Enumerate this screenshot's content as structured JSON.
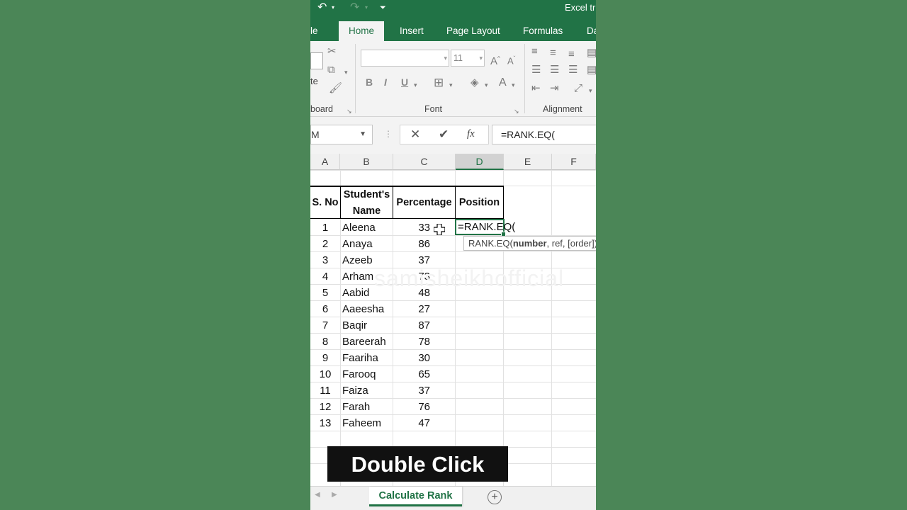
{
  "window": {
    "title": "Excel tri"
  },
  "qat": {
    "undo": "↶",
    "redo": "↷",
    "customize": "⏷"
  },
  "tabs": [
    {
      "label": "le"
    },
    {
      "label": "Home"
    },
    {
      "label": "Insert"
    },
    {
      "label": "Page Layout"
    },
    {
      "label": "Formulas"
    },
    {
      "label": "Da"
    }
  ],
  "ribbon": {
    "clipboard_label": "board",
    "paste_label": "te",
    "font_group_label": "Font",
    "alignment_group_label": "Alignment",
    "font_name": "",
    "font_size": "11",
    "bold": "B",
    "italic": "I",
    "underline": "U"
  },
  "formula_bar": {
    "name_box": "M",
    "fx": "fx",
    "formula": "=RANK.EQ("
  },
  "columns": [
    "A",
    "B",
    "C",
    "D",
    "E",
    "F"
  ],
  "selected_column": "D",
  "table": {
    "headers": [
      "S. No",
      "Student's Name",
      "Percentage",
      "Position"
    ],
    "header_name_line1": "Student's",
    "header_name_line2": "Name",
    "rows": [
      {
        "sno": "1",
        "name": "Aleena",
        "pct": "33"
      },
      {
        "sno": "2",
        "name": "Anaya",
        "pct": "86"
      },
      {
        "sno": "3",
        "name": "Azeeb",
        "pct": "37"
      },
      {
        "sno": "4",
        "name": "Arham",
        "pct": "73"
      },
      {
        "sno": "5",
        "name": "Aabid",
        "pct": "48"
      },
      {
        "sno": "6",
        "name": "Aaeesha",
        "pct": "27"
      },
      {
        "sno": "7",
        "name": "Baqir",
        "pct": "87"
      },
      {
        "sno": "8",
        "name": "Bareerah",
        "pct": "78"
      },
      {
        "sno": "9",
        "name": "Faariha",
        "pct": "30"
      },
      {
        "sno": "10",
        "name": "Farooq",
        "pct": "65"
      },
      {
        "sno": "11",
        "name": "Faiza",
        "pct": "37"
      },
      {
        "sno": "12",
        "name": "Farah",
        "pct": "76"
      },
      {
        "sno": "13",
        "name": "Faheem",
        "pct": "47"
      }
    ]
  },
  "active_cell": {
    "value": "=RANK.EQ("
  },
  "tooltip": {
    "fn": "RANK.EQ(",
    "arg1": "number",
    "rest": ", ref, [order])"
  },
  "watermark": "samisheikhofficial",
  "caption": "Double Click",
  "sheet_tabs": {
    "active": "Calculate Rank",
    "add": "+"
  },
  "colors": {
    "excel_green": "#217346",
    "background": "#4a8556"
  }
}
